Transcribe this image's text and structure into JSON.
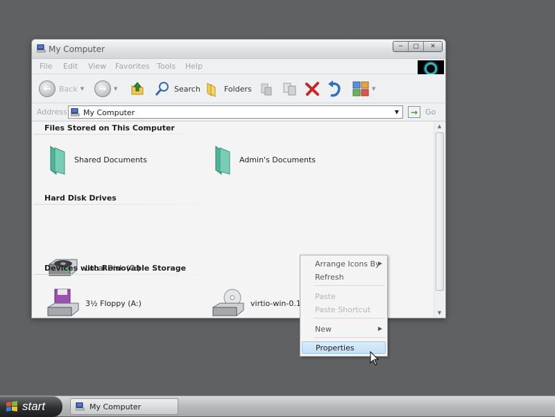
{
  "window": {
    "title": "My Computer",
    "caption_buttons": [
      "minimize",
      "maximize",
      "close"
    ]
  },
  "menubar": {
    "items": [
      "File",
      "Edit",
      "View",
      "Favorites",
      "Tools",
      "Help"
    ]
  },
  "toolbar": {
    "back_label": "Back",
    "search_label": "Search",
    "folders_label": "Folders"
  },
  "address": {
    "label": "Address",
    "value": "My Computer",
    "go_label": "Go"
  },
  "groups": {
    "files": {
      "header": "Files Stored on This Computer",
      "items": [
        "Shared Documents",
        "Admin's Documents"
      ]
    },
    "drives": {
      "header": "Hard Disk Drives",
      "items": [
        "Local Disk (C:)"
      ]
    },
    "removable": {
      "header": "Devices with Removable Storage",
      "items": [
        "3½ Floppy (A:)",
        "virtio-win-0.1.19"
      ]
    }
  },
  "context_menu": {
    "items": [
      {
        "label": "Arrange Icons By",
        "enabled": true,
        "submenu": true
      },
      {
        "label": "Refresh",
        "enabled": true
      },
      {
        "label": "Paste",
        "enabled": false
      },
      {
        "label": "Paste Shortcut",
        "enabled": false
      },
      {
        "label": "New",
        "enabled": true,
        "submenu": true
      },
      {
        "label": "Properties",
        "enabled": true,
        "highlighted": true
      }
    ]
  },
  "taskbar": {
    "start_label": "start",
    "tasks": [
      "My Computer"
    ]
  },
  "colors": {
    "desktop": "#5f6162",
    "highlight": "#c2e0f5",
    "logo_ring": "#2fb6c7"
  }
}
